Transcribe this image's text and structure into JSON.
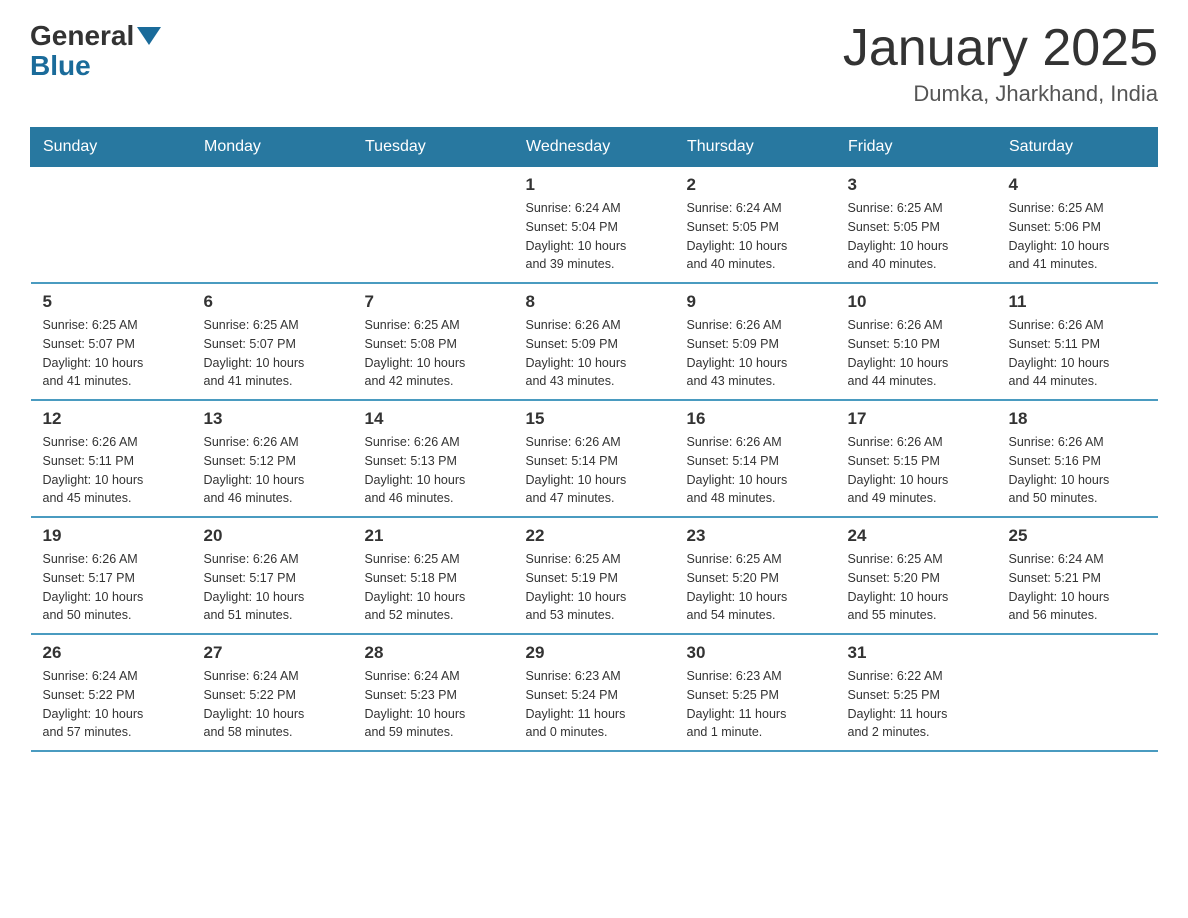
{
  "header": {
    "logo_general": "General",
    "logo_blue": "Blue",
    "month_title": "January 2025",
    "location": "Dumka, Jharkhand, India"
  },
  "days_of_week": [
    "Sunday",
    "Monday",
    "Tuesday",
    "Wednesday",
    "Thursday",
    "Friday",
    "Saturday"
  ],
  "weeks": [
    [
      {
        "day": "",
        "info": ""
      },
      {
        "day": "",
        "info": ""
      },
      {
        "day": "",
        "info": ""
      },
      {
        "day": "1",
        "info": "Sunrise: 6:24 AM\nSunset: 5:04 PM\nDaylight: 10 hours\nand 39 minutes."
      },
      {
        "day": "2",
        "info": "Sunrise: 6:24 AM\nSunset: 5:05 PM\nDaylight: 10 hours\nand 40 minutes."
      },
      {
        "day": "3",
        "info": "Sunrise: 6:25 AM\nSunset: 5:05 PM\nDaylight: 10 hours\nand 40 minutes."
      },
      {
        "day": "4",
        "info": "Sunrise: 6:25 AM\nSunset: 5:06 PM\nDaylight: 10 hours\nand 41 minutes."
      }
    ],
    [
      {
        "day": "5",
        "info": "Sunrise: 6:25 AM\nSunset: 5:07 PM\nDaylight: 10 hours\nand 41 minutes."
      },
      {
        "day": "6",
        "info": "Sunrise: 6:25 AM\nSunset: 5:07 PM\nDaylight: 10 hours\nand 41 minutes."
      },
      {
        "day": "7",
        "info": "Sunrise: 6:25 AM\nSunset: 5:08 PM\nDaylight: 10 hours\nand 42 minutes."
      },
      {
        "day": "8",
        "info": "Sunrise: 6:26 AM\nSunset: 5:09 PM\nDaylight: 10 hours\nand 43 minutes."
      },
      {
        "day": "9",
        "info": "Sunrise: 6:26 AM\nSunset: 5:09 PM\nDaylight: 10 hours\nand 43 minutes."
      },
      {
        "day": "10",
        "info": "Sunrise: 6:26 AM\nSunset: 5:10 PM\nDaylight: 10 hours\nand 44 minutes."
      },
      {
        "day": "11",
        "info": "Sunrise: 6:26 AM\nSunset: 5:11 PM\nDaylight: 10 hours\nand 44 minutes."
      }
    ],
    [
      {
        "day": "12",
        "info": "Sunrise: 6:26 AM\nSunset: 5:11 PM\nDaylight: 10 hours\nand 45 minutes."
      },
      {
        "day": "13",
        "info": "Sunrise: 6:26 AM\nSunset: 5:12 PM\nDaylight: 10 hours\nand 46 minutes."
      },
      {
        "day": "14",
        "info": "Sunrise: 6:26 AM\nSunset: 5:13 PM\nDaylight: 10 hours\nand 46 minutes."
      },
      {
        "day": "15",
        "info": "Sunrise: 6:26 AM\nSunset: 5:14 PM\nDaylight: 10 hours\nand 47 minutes."
      },
      {
        "day": "16",
        "info": "Sunrise: 6:26 AM\nSunset: 5:14 PM\nDaylight: 10 hours\nand 48 minutes."
      },
      {
        "day": "17",
        "info": "Sunrise: 6:26 AM\nSunset: 5:15 PM\nDaylight: 10 hours\nand 49 minutes."
      },
      {
        "day": "18",
        "info": "Sunrise: 6:26 AM\nSunset: 5:16 PM\nDaylight: 10 hours\nand 50 minutes."
      }
    ],
    [
      {
        "day": "19",
        "info": "Sunrise: 6:26 AM\nSunset: 5:17 PM\nDaylight: 10 hours\nand 50 minutes."
      },
      {
        "day": "20",
        "info": "Sunrise: 6:26 AM\nSunset: 5:17 PM\nDaylight: 10 hours\nand 51 minutes."
      },
      {
        "day": "21",
        "info": "Sunrise: 6:25 AM\nSunset: 5:18 PM\nDaylight: 10 hours\nand 52 minutes."
      },
      {
        "day": "22",
        "info": "Sunrise: 6:25 AM\nSunset: 5:19 PM\nDaylight: 10 hours\nand 53 minutes."
      },
      {
        "day": "23",
        "info": "Sunrise: 6:25 AM\nSunset: 5:20 PM\nDaylight: 10 hours\nand 54 minutes."
      },
      {
        "day": "24",
        "info": "Sunrise: 6:25 AM\nSunset: 5:20 PM\nDaylight: 10 hours\nand 55 minutes."
      },
      {
        "day": "25",
        "info": "Sunrise: 6:24 AM\nSunset: 5:21 PM\nDaylight: 10 hours\nand 56 minutes."
      }
    ],
    [
      {
        "day": "26",
        "info": "Sunrise: 6:24 AM\nSunset: 5:22 PM\nDaylight: 10 hours\nand 57 minutes."
      },
      {
        "day": "27",
        "info": "Sunrise: 6:24 AM\nSunset: 5:22 PM\nDaylight: 10 hours\nand 58 minutes."
      },
      {
        "day": "28",
        "info": "Sunrise: 6:24 AM\nSunset: 5:23 PM\nDaylight: 10 hours\nand 59 minutes."
      },
      {
        "day": "29",
        "info": "Sunrise: 6:23 AM\nSunset: 5:24 PM\nDaylight: 11 hours\nand 0 minutes."
      },
      {
        "day": "30",
        "info": "Sunrise: 6:23 AM\nSunset: 5:25 PM\nDaylight: 11 hours\nand 1 minute."
      },
      {
        "day": "31",
        "info": "Sunrise: 6:22 AM\nSunset: 5:25 PM\nDaylight: 11 hours\nand 2 minutes."
      },
      {
        "day": "",
        "info": ""
      }
    ]
  ]
}
